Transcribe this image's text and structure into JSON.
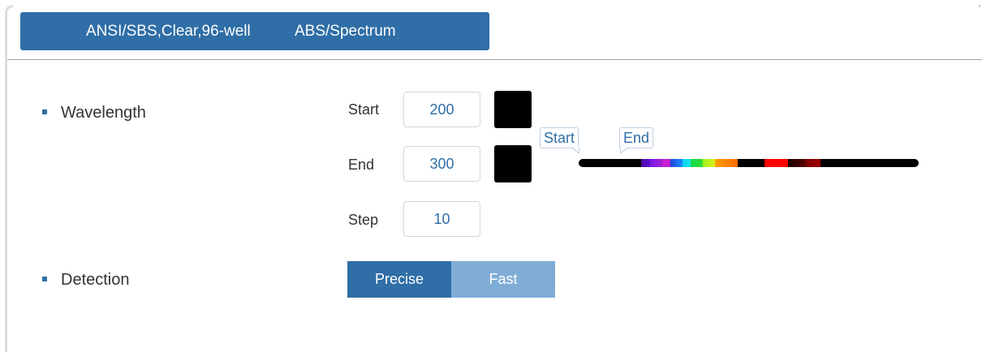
{
  "header": {
    "plate_type": "ANSI/SBS,Clear,96-well",
    "mode": "ABS/Spectrum"
  },
  "wavelength": {
    "label": "Wavelength",
    "start_label": "Start",
    "start_value": "200",
    "end_label": "End",
    "end_value": "300",
    "step_label": "Step",
    "step_value": "10",
    "start_color": "#000000",
    "end_color": "#000000",
    "spectrum_markers": {
      "start": "Start",
      "end": "End"
    }
  },
  "detection": {
    "label": "Detection",
    "options": [
      "Precise",
      "Fast"
    ],
    "selected": "Precise"
  },
  "colors": {
    "accent": "#2f6ea6",
    "accent_light": "#7fadd6",
    "value_text": "#2f6ea6"
  }
}
